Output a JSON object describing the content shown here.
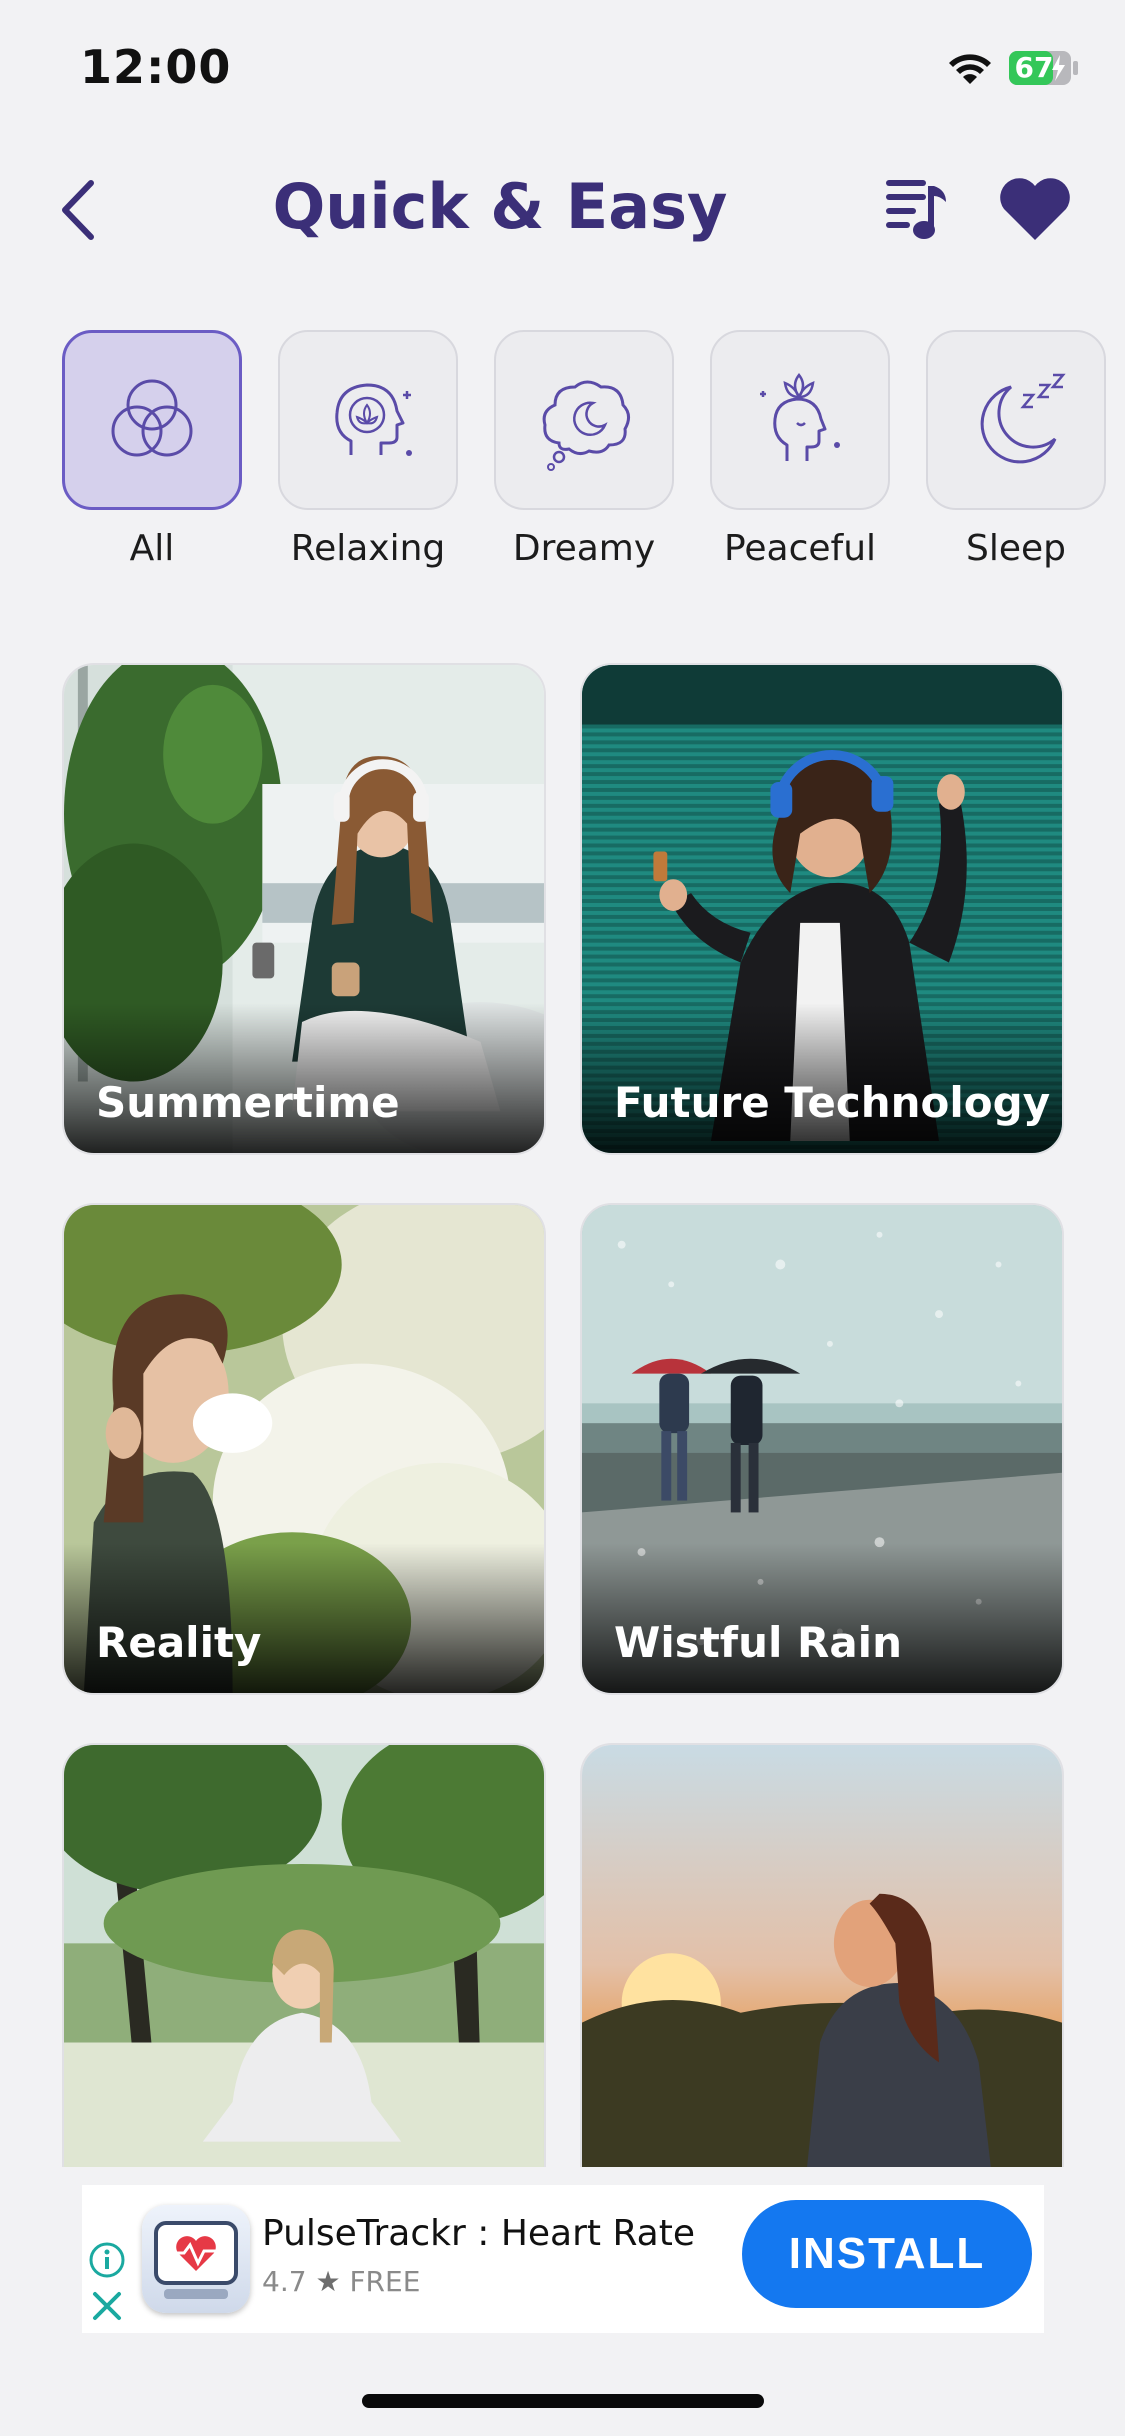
{
  "status_bar": {
    "time": "12:00",
    "battery": "67"
  },
  "header": {
    "title": "Quick & Easy"
  },
  "categories": [
    {
      "label": "All",
      "icon": "circles-icon",
      "active": true
    },
    {
      "label": "Relaxing",
      "icon": "head-lotus-icon",
      "active": false
    },
    {
      "label": "Dreamy",
      "icon": "cloud-moon-icon",
      "active": false
    },
    {
      "label": "Peaceful",
      "icon": "face-lotus-icon",
      "active": false
    },
    {
      "label": "Sleep",
      "icon": "moon-zzz-icon",
      "active": false
    }
  ],
  "cards": [
    {
      "title": "Summertime"
    },
    {
      "title": "Future Technology"
    },
    {
      "title": "Reality"
    },
    {
      "title": "Wistful Rain"
    },
    {
      "title": ""
    },
    {
      "title": ""
    }
  ],
  "ad": {
    "app_name": "PulseTrackr : Heart Rate",
    "rating": "4.7",
    "price": "FREE",
    "install_label": "INSTALL"
  },
  "colors": {
    "accent": "#3b2f78",
    "install": "#1478f0",
    "active_chip": "#d5d0ec"
  }
}
